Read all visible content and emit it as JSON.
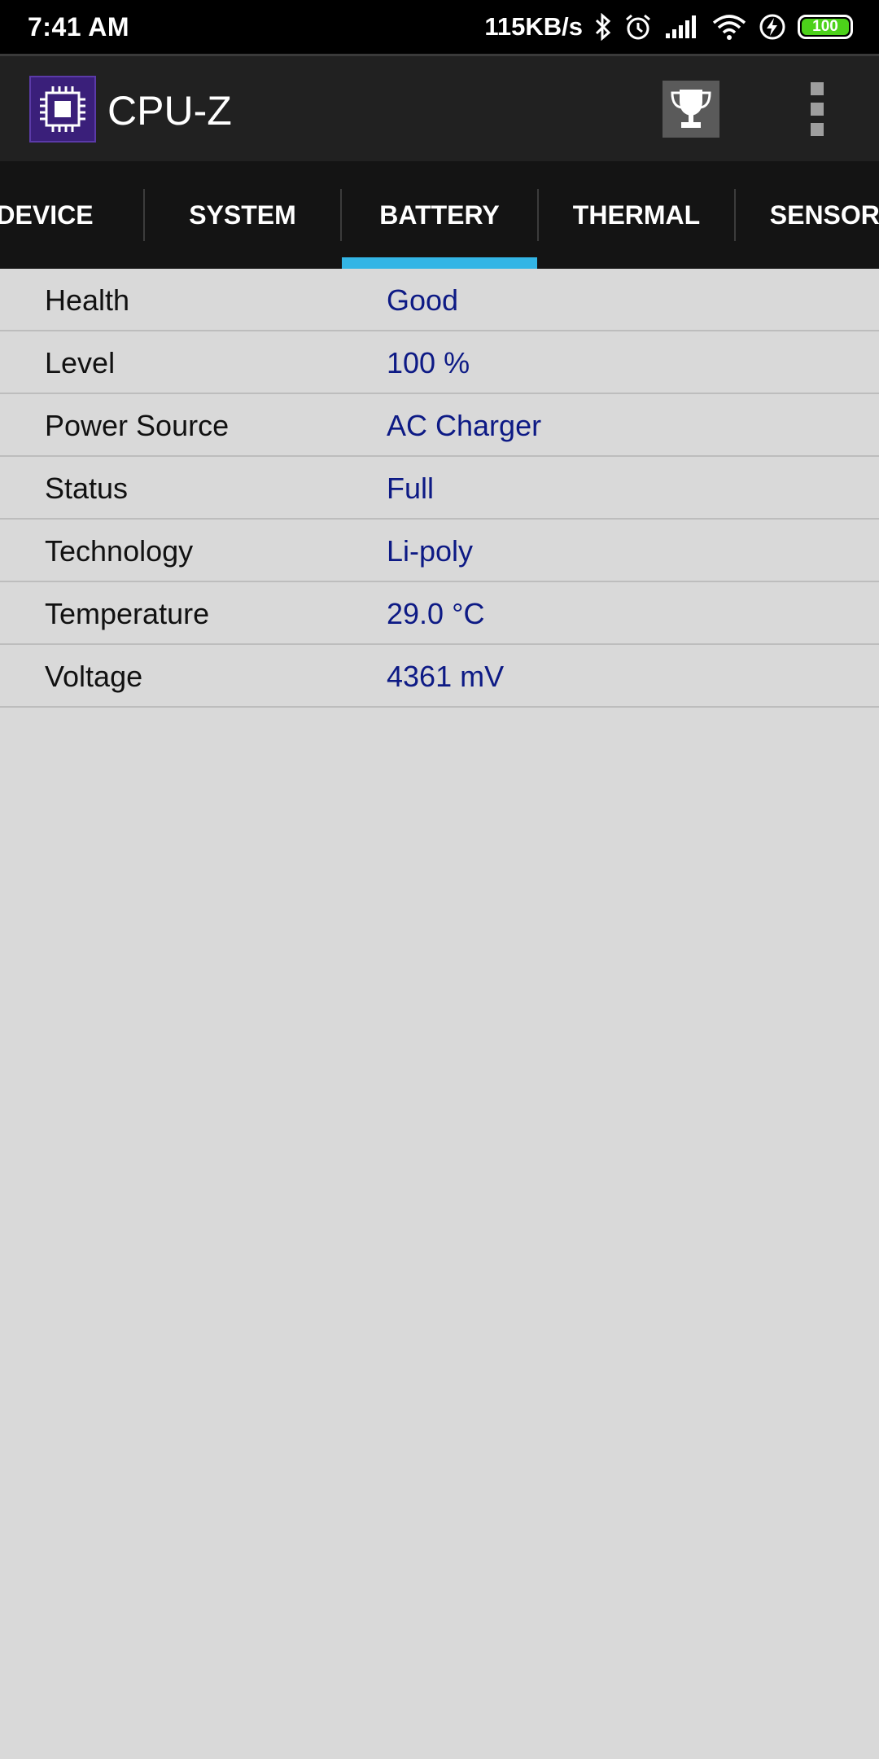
{
  "status_bar": {
    "time": "7:41 AM",
    "network_speed": "115KB/s",
    "battery_level": "100",
    "icons": [
      "bluetooth-icon",
      "alarm-icon",
      "signal-icon",
      "wifi-icon",
      "charging-icon",
      "battery-icon"
    ]
  },
  "app_bar": {
    "title": "CPU-Z",
    "logo_icon": "cpu-chip-icon",
    "actions": [
      "trophy-icon",
      "overflow-menu-icon"
    ]
  },
  "tabs": [
    {
      "label": "DEVICE"
    },
    {
      "label": "SYSTEM"
    },
    {
      "label": "BATTERY",
      "selected": true
    },
    {
      "label": "THERMAL"
    },
    {
      "label": "SENSORS"
    }
  ],
  "battery": {
    "rows": [
      {
        "label": "Health",
        "value": "Good"
      },
      {
        "label": "Level",
        "value": "100 %"
      },
      {
        "label": "Power Source",
        "value": "AC Charger"
      },
      {
        "label": "Status",
        "value": "Full"
      },
      {
        "label": "Technology",
        "value": "Li-poly"
      },
      {
        "label": "Temperature",
        "value": "29.0 °C"
      },
      {
        "label": "Voltage",
        "value": "4361 mV"
      }
    ]
  },
  "colors": {
    "accent": "#33b5e5",
    "value_text": "#0d1a85",
    "background": "#d9d9d9",
    "battery_fill": "#4cd11a"
  }
}
